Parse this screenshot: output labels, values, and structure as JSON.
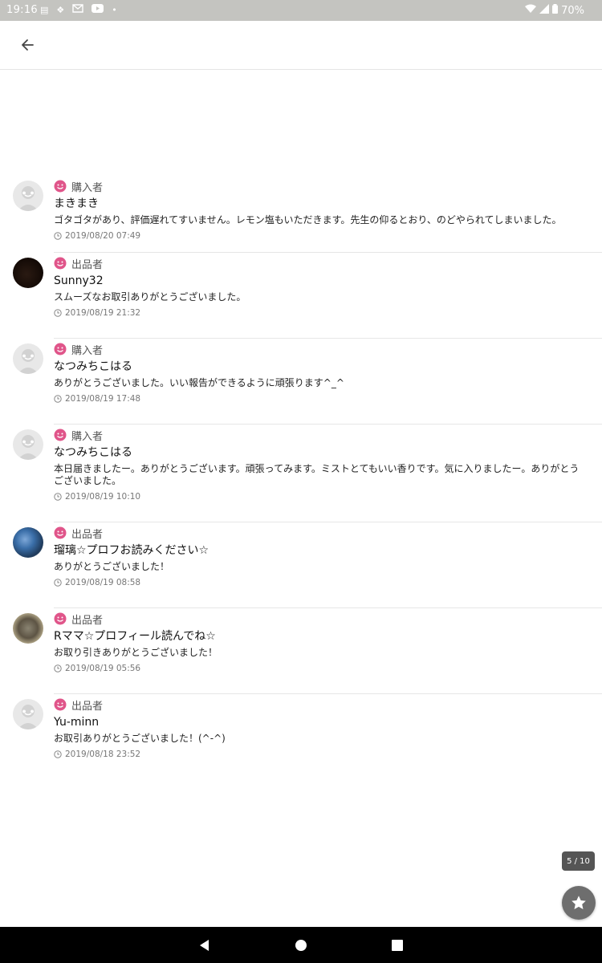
{
  "status_bar": {
    "time": "19:16",
    "notification_icons": [
      "sim-icon",
      "dropbox-icon",
      "mail-icon",
      "youtube-icon",
      "dot-icon"
    ],
    "battery": "70%"
  },
  "reviews": [
    {
      "avatar": "default",
      "role": "購入者",
      "name": "まきまき",
      "message": "ゴタゴタがあり、評価遅れてすいません。レモン塩もいただきます。先生の仰るとおり、のどやられてしまいました。",
      "date": "2019/08/20 07:49"
    },
    {
      "avatar": "dark",
      "role": "出品者",
      "name": "Sunny32",
      "message": "スムーズなお取引ありがとうございました。",
      "date": "2019/08/19 21:32"
    },
    {
      "avatar": "default",
      "role": "購入者",
      "name": "なつみちこはる",
      "message": "ありがとうございました。いい報告ができるように頑張ります^_^",
      "date": "2019/08/19 17:48"
    },
    {
      "avatar": "default",
      "role": "購入者",
      "name": "なつみちこはる",
      "message": "本日届きましたー。ありがとうございます。頑張ってみます。ミストとてもいい香りです。気に入りましたー。ありがとうございました。",
      "date": "2019/08/19 10:10"
    },
    {
      "avatar": "blue",
      "role": "出品者",
      "name": "瑠璃☆プロフお読みください☆",
      "message": "ありがとうございました！",
      "date": "2019/08/19 08:58"
    },
    {
      "avatar": "cat",
      "role": "出品者",
      "name": "Rママ☆プロフィール読んでね☆",
      "message": "お取り引きありがとうございました！",
      "date": "2019/08/19 05:56"
    },
    {
      "avatar": "default",
      "role": "出品者",
      "name": "Yu-minn",
      "message": "お取引ありがとうございました！(^-^)",
      "date": "2019/08/18 23:52"
    }
  ],
  "page_indicator": "5 / 10",
  "colors": {
    "role_icon": "#e0558a",
    "status_bar_bg": "#c4c4c0",
    "divider": "#e6e6e6"
  }
}
